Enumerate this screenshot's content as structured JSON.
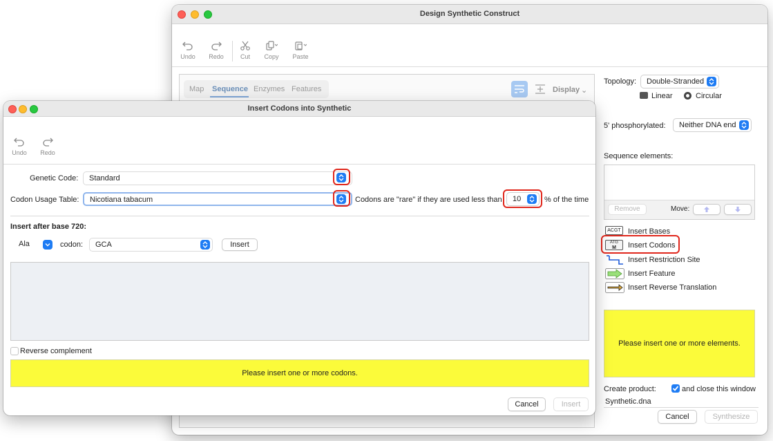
{
  "main_window": {
    "title": "Design Synthetic Construct",
    "toolbar": {
      "undo": "Undo",
      "redo": "Redo",
      "cut": "Cut",
      "copy": "Copy",
      "paste": "Paste"
    },
    "tabs": [
      "Map",
      "Sequence",
      "Enzymes",
      "Features"
    ],
    "active_tab": "Sequence",
    "display_label": "Display",
    "topology": {
      "label": "Topology:",
      "value": "Double-Stranded",
      "linear": "Linear",
      "circular": "Circular"
    },
    "phosphorylated": {
      "label": "5' phosphorylated:",
      "value": "Neither DNA end"
    },
    "sequence_elements": {
      "label": "Sequence elements:",
      "remove": "Remove",
      "move": "Move:"
    },
    "insert_options": [
      {
        "icon_text": "ACGT",
        "label": "Insert Bases"
      },
      {
        "icon_text": "ATG M",
        "label": "Insert Codons"
      },
      {
        "icon_text": "",
        "label": "Insert Restriction Site"
      },
      {
        "icon_text": "",
        "label": "Insert Feature"
      },
      {
        "icon_text": "",
        "label": "Insert Reverse Translation"
      }
    ],
    "status_message": "Please insert one or more elements.",
    "create_product": {
      "label": "Create product:",
      "checkbox_label": "and close this window",
      "checked": true,
      "filename": "Synthetic.dna"
    },
    "cancel": "Cancel",
    "synthesize": "Synthesize"
  },
  "dialog": {
    "title": "Insert Codons into Synthetic",
    "toolbar": {
      "undo": "Undo",
      "redo": "Redo"
    },
    "genetic_code": {
      "label": "Genetic Code:",
      "value": "Standard"
    },
    "codon_usage": {
      "label": "Codon Usage Table:",
      "value": "Nicotiana tabacum",
      "rare_prefix": "Codons are \"rare\" if they are used less than",
      "rare_value": "10",
      "rare_suffix": "% of the time"
    },
    "insert_after": "Insert after base 720:",
    "amino_acid": "Ala",
    "codon_label": "codon:",
    "codon_value": "GCA",
    "insert_button": "Insert",
    "reverse_complement": "Reverse complement",
    "status_message": "Please insert one or more codons.",
    "cancel": "Cancel",
    "insert": "Insert"
  },
  "colors": {
    "accent": "#1e7cf4",
    "highlight": "#e0261b",
    "status_yellow": "#fbfb3a"
  }
}
